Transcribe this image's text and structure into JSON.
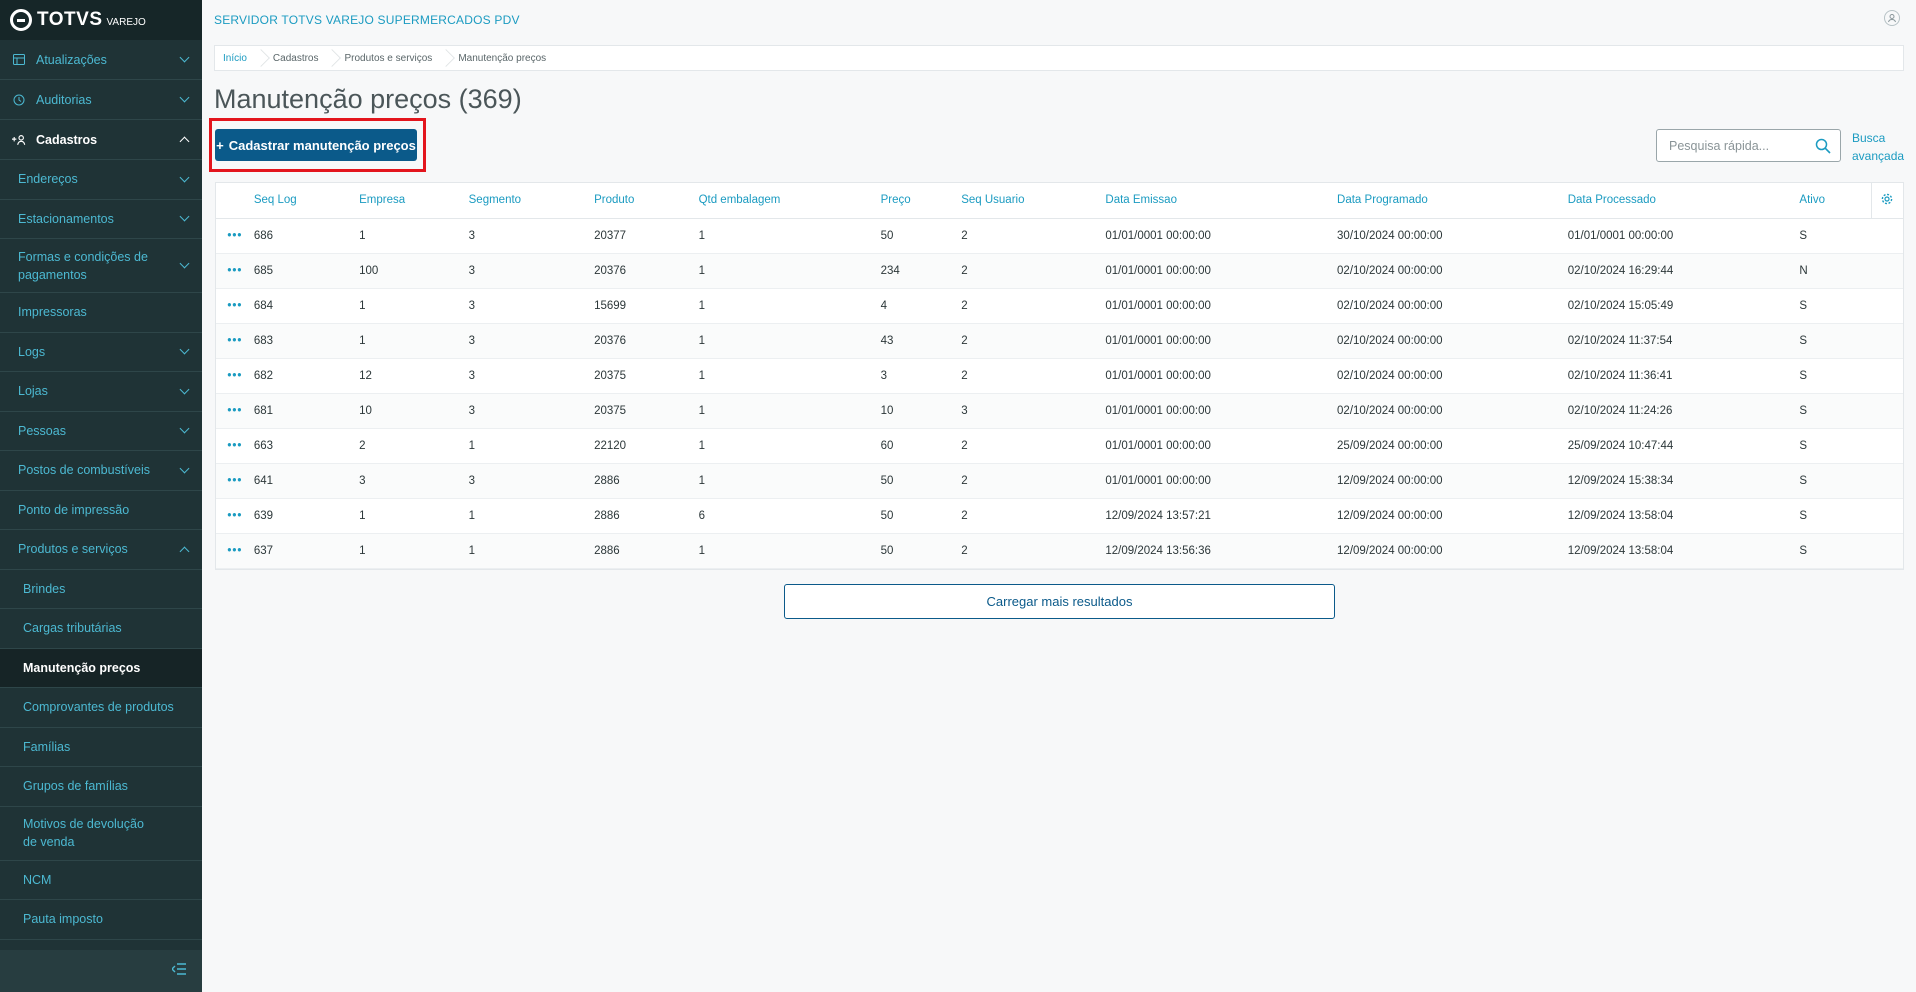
{
  "app": {
    "brand": "TOTVS",
    "product": "VAREJO"
  },
  "sidebar": {
    "items": [
      {
        "label": "Atualizações",
        "icon": "table-icon",
        "state": "collapsed",
        "level": "top"
      },
      {
        "label": "Auditorias",
        "icon": "history-icon",
        "state": "collapsed",
        "level": "top"
      },
      {
        "label": "Cadastros",
        "icon": "add-user-icon",
        "state": "expanded",
        "level": "top"
      },
      {
        "label": "Endereços",
        "state": "collapsed",
        "level": "group"
      },
      {
        "label": "Estacionamentos",
        "state": "collapsed",
        "level": "group"
      },
      {
        "label": "Formas e condições de pagamentos",
        "state": "collapsed",
        "level": "group"
      },
      {
        "label": "Impressoras",
        "state": "none",
        "level": "group"
      },
      {
        "label": "Logs",
        "state": "collapsed",
        "level": "group"
      },
      {
        "label": "Lojas",
        "state": "collapsed",
        "level": "group"
      },
      {
        "label": "Pessoas",
        "state": "collapsed",
        "level": "group"
      },
      {
        "label": "Postos de combustíveis",
        "state": "collapsed",
        "level": "group"
      },
      {
        "label": "Ponto de impressão",
        "state": "none",
        "level": "group"
      },
      {
        "label": "Produtos e serviços",
        "state": "expanded",
        "level": "group"
      },
      {
        "label": "Brindes",
        "state": "none",
        "level": "sub"
      },
      {
        "label": "Cargas tributárias",
        "state": "none",
        "level": "sub"
      },
      {
        "label": "Manutenção preços",
        "state": "active",
        "level": "sub"
      },
      {
        "label": "Comprovantes de produtos",
        "state": "none",
        "level": "sub"
      },
      {
        "label": "Famílias",
        "state": "none",
        "level": "sub"
      },
      {
        "label": "Grupos de famílias",
        "state": "none",
        "level": "sub"
      },
      {
        "label": "Motivos de devolução de venda",
        "state": "none",
        "level": "sub"
      },
      {
        "label": "NCM",
        "state": "none",
        "level": "sub"
      },
      {
        "label": "Pauta imposto",
        "state": "none",
        "level": "sub"
      }
    ],
    "collapse_icon": "menu-collapse-icon"
  },
  "header": {
    "server_title": "SERVIDOR TOTVS VAREJO SUPERMERCADOS PDV"
  },
  "breadcrumb": [
    "Início",
    "Cadastros",
    "Produtos e serviços",
    "Manutenção preços"
  ],
  "page": {
    "title": "Manutenção preços (369)",
    "new_button": "Cadastrar manutenção preços",
    "new_button_icon": "+",
    "search_placeholder": "Pesquisa rápida...",
    "advanced_search": [
      "Busca",
      "avançada"
    ],
    "load_more": "Carregar mais resultados"
  },
  "table": {
    "columns": [
      "Seq Log",
      "Empresa",
      "Segmento",
      "Produto",
      "Qtd embalagem",
      "Preço",
      "Seq Usuario",
      "Data Emissao",
      "Data Programado",
      "Data Processado",
      "Ativo"
    ],
    "rows": [
      [
        "686",
        "1",
        "3",
        "20377",
        "1",
        "50",
        "2",
        "01/01/0001 00:00:00",
        "30/10/2024 00:00:00",
        "01/01/0001 00:00:00",
        "S"
      ],
      [
        "685",
        "100",
        "3",
        "20376",
        "1",
        "234",
        "2",
        "01/01/0001 00:00:00",
        "02/10/2024 00:00:00",
        "02/10/2024 16:29:44",
        "N"
      ],
      [
        "684",
        "1",
        "3",
        "15699",
        "1",
        "4",
        "2",
        "01/01/0001 00:00:00",
        "02/10/2024 00:00:00",
        "02/10/2024 15:05:49",
        "S"
      ],
      [
        "683",
        "1",
        "3",
        "20376",
        "1",
        "43",
        "2",
        "01/01/0001 00:00:00",
        "02/10/2024 00:00:00",
        "02/10/2024 11:37:54",
        "S"
      ],
      [
        "682",
        "12",
        "3",
        "20375",
        "1",
        "3",
        "2",
        "01/01/0001 00:00:00",
        "02/10/2024 00:00:00",
        "02/10/2024 11:36:41",
        "S"
      ],
      [
        "681",
        "10",
        "3",
        "20375",
        "1",
        "10",
        "3",
        "01/01/0001 00:00:00",
        "02/10/2024 00:00:00",
        "02/10/2024 11:24:26",
        "S"
      ],
      [
        "663",
        "2",
        "1",
        "22120",
        "1",
        "60",
        "2",
        "01/01/0001 00:00:00",
        "25/09/2024 00:00:00",
        "25/09/2024 10:47:44",
        "S"
      ],
      [
        "641",
        "3",
        "3",
        "2886",
        "1",
        "50",
        "2",
        "01/01/0001 00:00:00",
        "12/09/2024 00:00:00",
        "12/09/2024 15:38:34",
        "S"
      ],
      [
        "639",
        "1",
        "1",
        "2886",
        "6",
        "50",
        "2",
        "12/09/2024 13:57:21",
        "12/09/2024 00:00:00",
        "12/09/2024 13:58:04",
        "S"
      ],
      [
        "637",
        "1",
        "1",
        "2886",
        "1",
        "50",
        "2",
        "12/09/2024 13:56:36",
        "12/09/2024 00:00:00",
        "12/09/2024 13:58:04",
        "S"
      ]
    ],
    "row_action_label": "•••"
  }
}
